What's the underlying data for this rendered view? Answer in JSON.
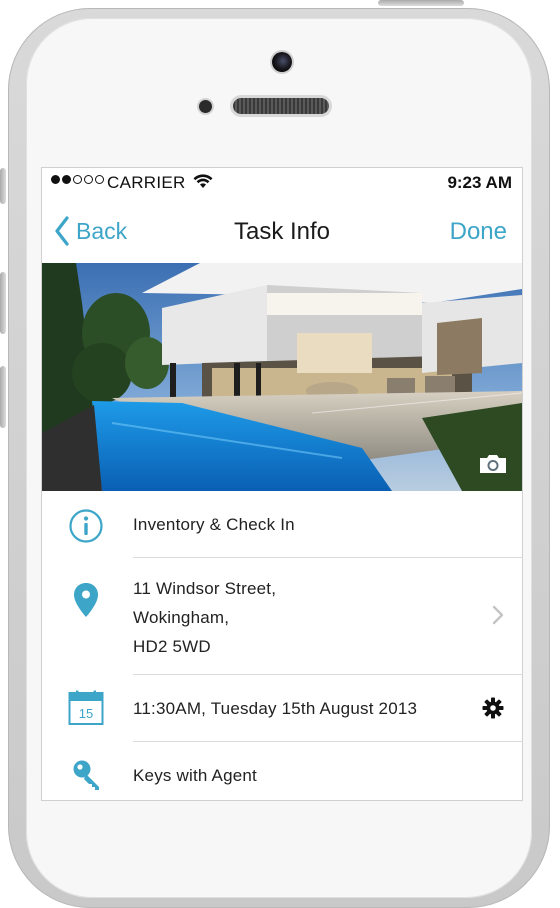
{
  "status_bar": {
    "signal_filled": 2,
    "signal_total": 5,
    "carrier": "CARRIER",
    "time": "9:23 AM"
  },
  "nav": {
    "back_label": "Back",
    "title": "Task Info",
    "done_label": "Done"
  },
  "rows": [
    {
      "icon": "info-icon",
      "lines": [
        "Inventory & Check In"
      ]
    },
    {
      "icon": "location-pin-icon",
      "lines": [
        "11 Windsor Street,",
        "Wokingham,",
        "HD2 5WD"
      ],
      "accessory": "chevron-right-icon"
    },
    {
      "icon": "calendar-icon",
      "calendar_day": "15",
      "lines": [
        "11:30AM, Tuesday 15th August 2013"
      ],
      "accessory": "gear-icon"
    },
    {
      "icon": "key-icon",
      "lines": [
        "Keys with Agent"
      ]
    }
  ],
  "colors": {
    "accent": "#3da5c8",
    "text": "#222222",
    "divider": "#dcdcdc"
  }
}
